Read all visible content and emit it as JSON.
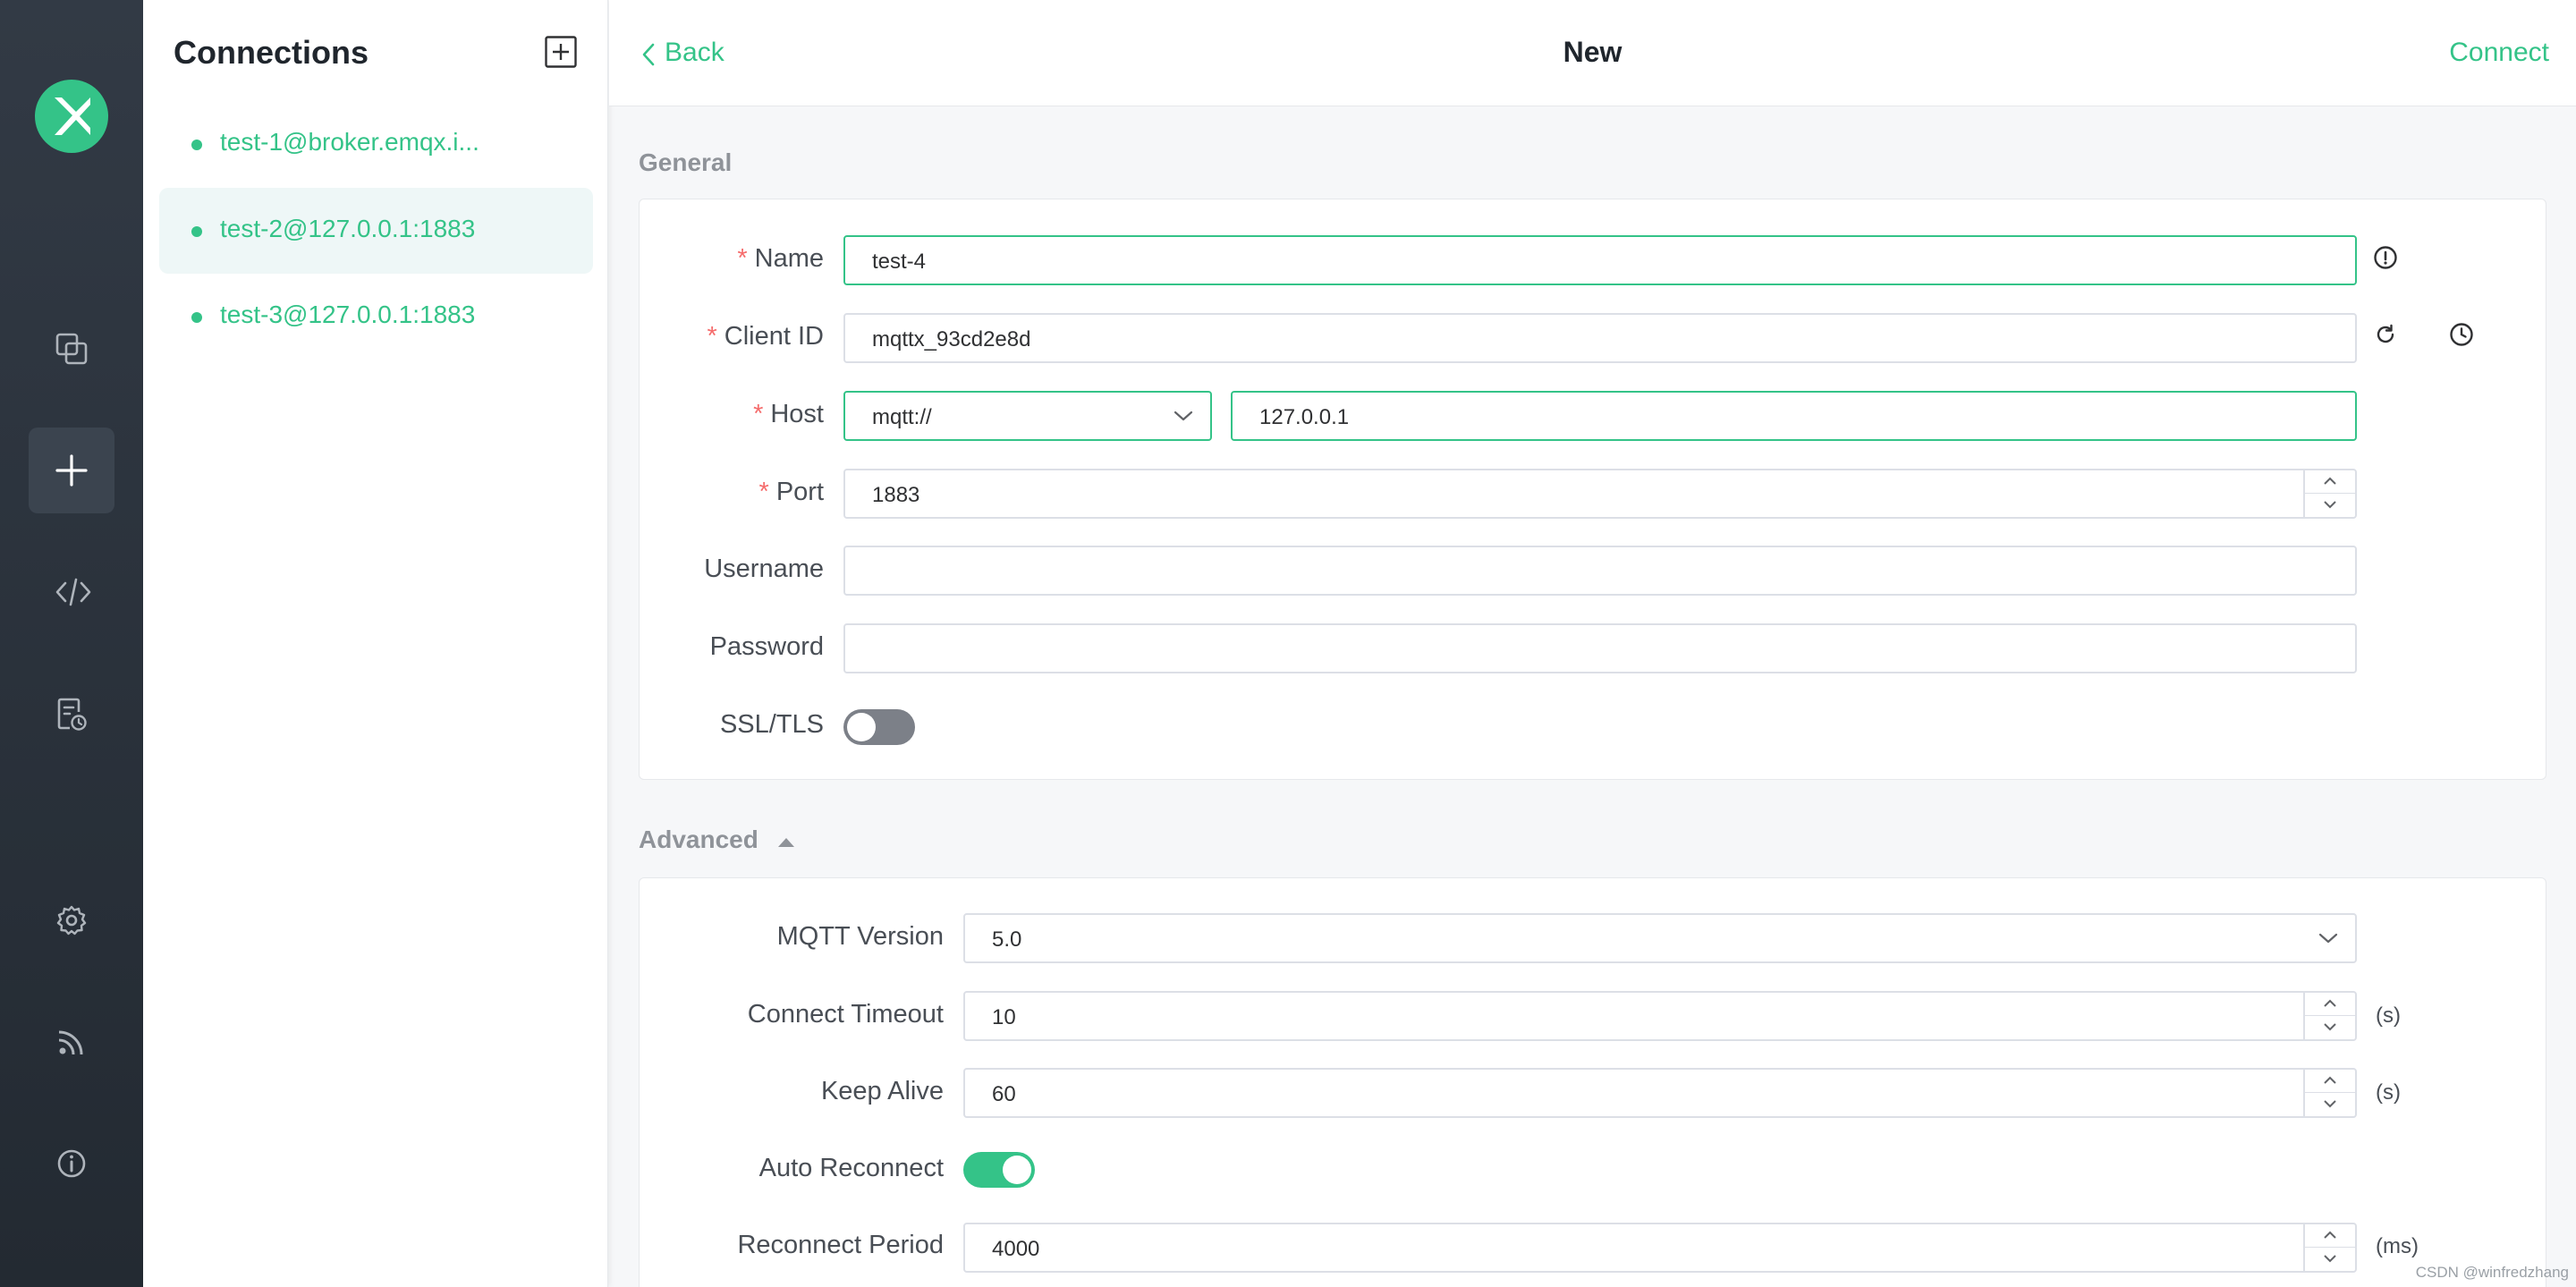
{
  "nav": {
    "logo": "mqttx-logo",
    "items": [
      {
        "icon": "connections-icon"
      },
      {
        "icon": "plus-icon",
        "active": true
      },
      {
        "icon": "code-icon"
      },
      {
        "icon": "log-icon"
      },
      {
        "icon": "gear-icon"
      },
      {
        "icon": "rss-icon"
      },
      {
        "icon": "info-icon"
      }
    ]
  },
  "connections": {
    "title": "Connections",
    "add_icon": "plus-square-icon",
    "items": [
      {
        "label": "test-1@broker.emqx.i...",
        "status": "online"
      },
      {
        "label": "test-2@127.0.0.1:1883",
        "status": "online",
        "active": true
      },
      {
        "label": "test-3@127.0.0.1:1883",
        "status": "online"
      }
    ]
  },
  "header": {
    "back_label": "Back",
    "title": "New",
    "connect_label": "Connect"
  },
  "general": {
    "title": "General",
    "name_label": "Name",
    "name_value": "test-4",
    "client_id_label": "Client ID",
    "client_id_value": "mqttx_93cd2e8d",
    "host_label": "Host",
    "protocol_value": "mqtt://",
    "host_value": "127.0.0.1",
    "port_label": "Port",
    "port_value": "1883",
    "username_label": "Username",
    "username_value": "",
    "password_label": "Password",
    "password_value": "",
    "ssl_label": "SSL/TLS",
    "ssl_enabled": false,
    "required_mark": "*"
  },
  "advanced": {
    "title": "Advanced",
    "mqtt_version_label": "MQTT Version",
    "mqtt_version_value": "5.0",
    "connect_timeout_label": "Connect Timeout",
    "connect_timeout_value": "10",
    "connect_timeout_unit": "(s)",
    "keep_alive_label": "Keep Alive",
    "keep_alive_value": "60",
    "keep_alive_unit": "(s)",
    "auto_reconnect_label": "Auto Reconnect",
    "auto_reconnect_enabled": true,
    "reconnect_period_label": "Reconnect Period",
    "reconnect_period_value": "4000",
    "reconnect_period_unit": "(ms)"
  },
  "watermark": "CSDN @winfredzhang",
  "colors": {
    "accent": "#34c388",
    "nav_bg": "#2b333d",
    "required": "#f56c6c"
  }
}
